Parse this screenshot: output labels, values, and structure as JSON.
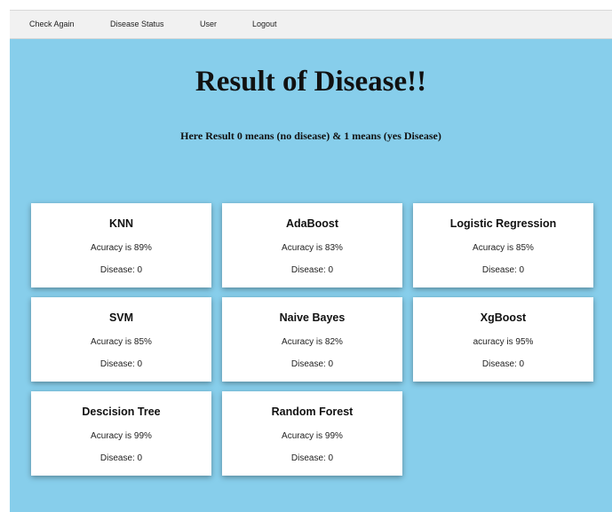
{
  "nav": {
    "items": [
      "Check Again",
      "Disease Status",
      "User",
      "Logout"
    ]
  },
  "header": {
    "title": "Result of Disease!!",
    "subtitle": "Here Result 0 means (no disease) & 1 means (yes Disease)"
  },
  "cards": [
    {
      "name": "KNN",
      "accuracy": "Acuracy is 89%",
      "disease": "Disease: 0"
    },
    {
      "name": "AdaBoost",
      "accuracy": "Acuracy is 83%",
      "disease": "Disease: 0"
    },
    {
      "name": "Logistic Regression",
      "accuracy": "Acuracy is 85%",
      "disease": "Disease: 0"
    },
    {
      "name": "SVM",
      "accuracy": "Acuracy is 85%",
      "disease": "Disease: 0"
    },
    {
      "name": "Naive Bayes",
      "accuracy": "Acuracy is 82%",
      "disease": "Disease: 0"
    },
    {
      "name": "XgBoost",
      "accuracy": "acuracy is 95%",
      "disease": "Disease: 0"
    },
    {
      "name": "Descision Tree",
      "accuracy": "Acuracy is 99%",
      "disease": "Disease: 0"
    },
    {
      "name": "Random Forest",
      "accuracy": "Acuracy is 99%",
      "disease": "Disease: 0"
    }
  ],
  "colors": {
    "background": "#87ceeb",
    "navbar": "#f1f1f1",
    "card": "#ffffff"
  }
}
